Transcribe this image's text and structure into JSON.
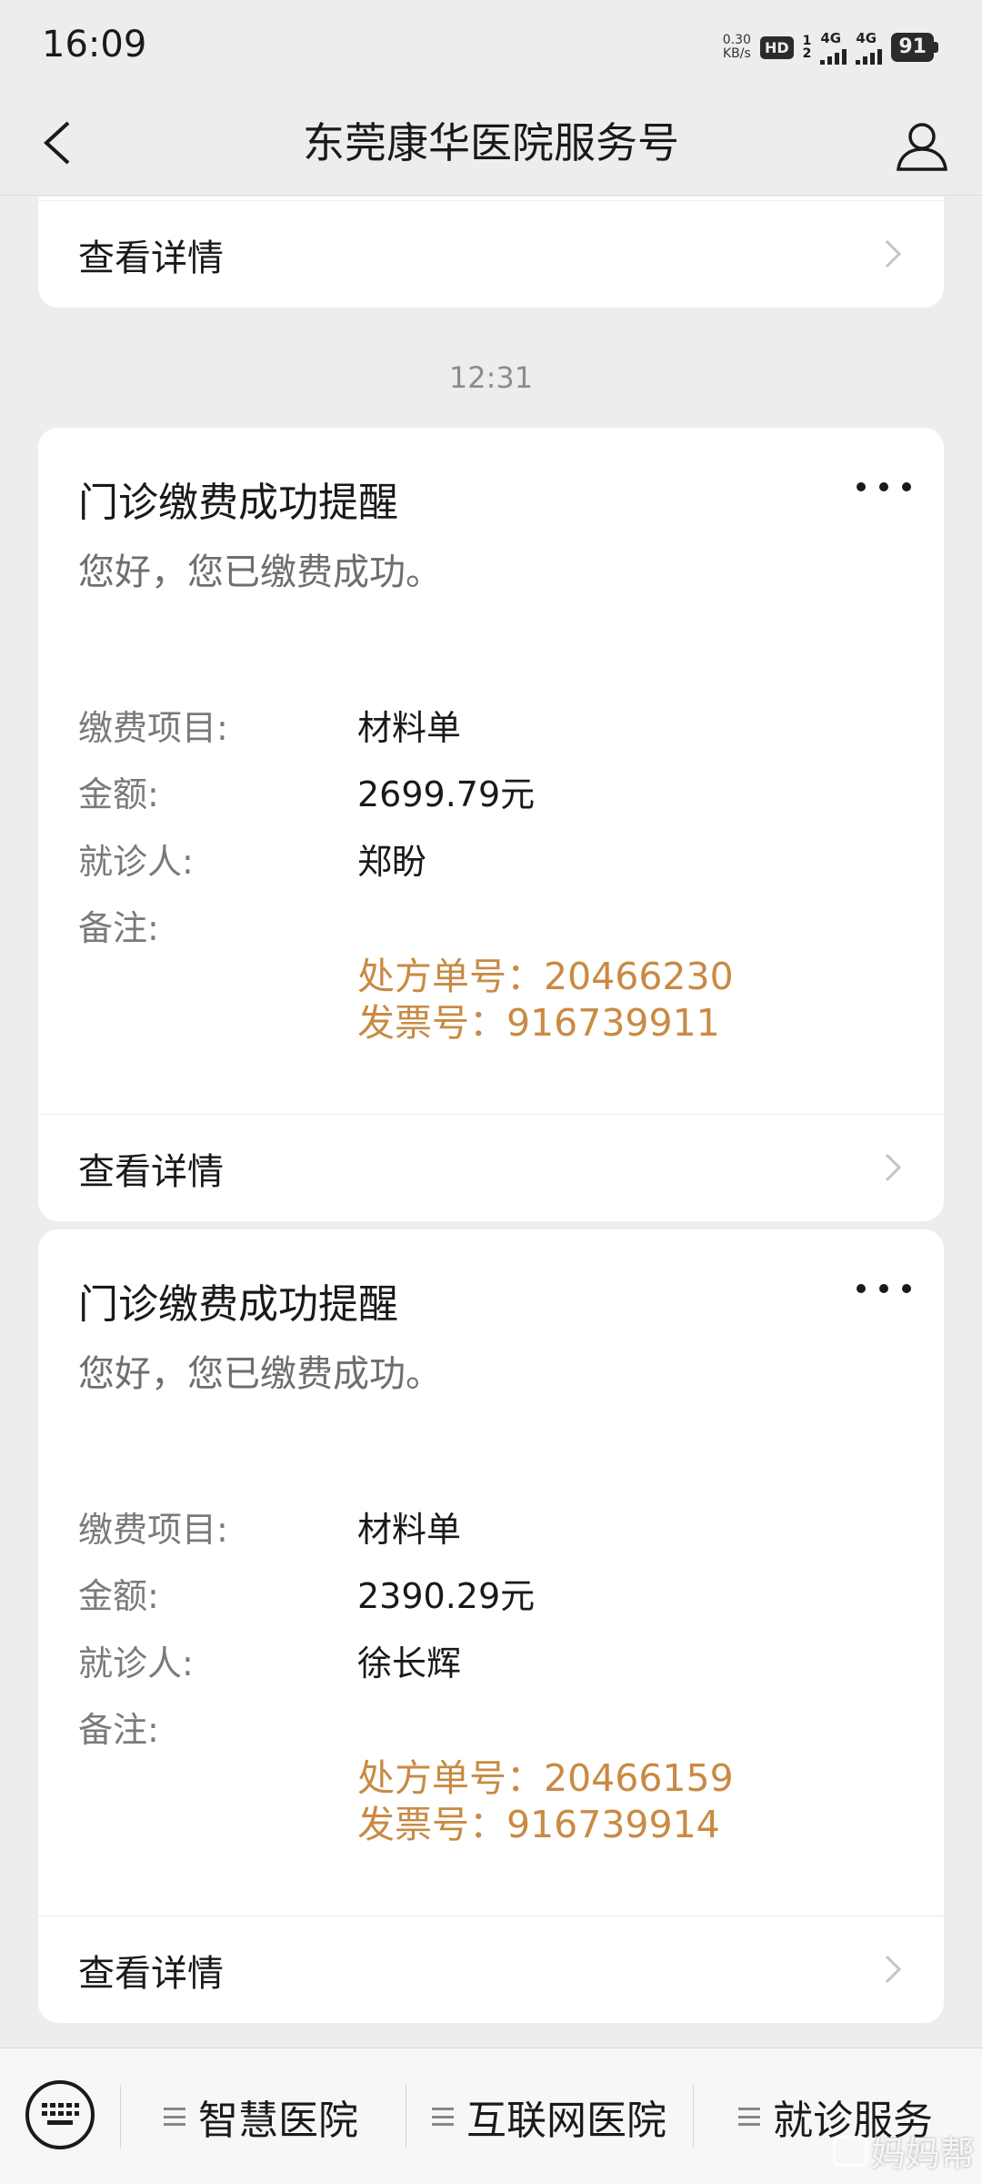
{
  "status_bar": {
    "time": "16:09",
    "net_speed_value": "0.30",
    "net_speed_unit": "KB/s",
    "hd_label": "HD",
    "sim_top": "1",
    "sim_bottom": "2",
    "net_type_1": "4G",
    "net_type_2": "4G",
    "battery": "91"
  },
  "nav": {
    "title": "东莞康华医院服务号"
  },
  "chat": {
    "top_card": {
      "details_label": "查看详情"
    },
    "timestamp": "12:31",
    "messages": [
      {
        "title": "门诊缴费成功提醒",
        "greeting": "您好，您已缴费成功。",
        "fields": [
          {
            "label": "缴费项目:",
            "value": "材料单"
          },
          {
            "label": "金额:",
            "value": "2699.79元"
          },
          {
            "label": "就诊人:",
            "value": "郑盼"
          },
          {
            "label": "备注:",
            "value": ""
          }
        ],
        "remark_lines": [
          "处方单号：20466230",
          "发票号：916739911"
        ],
        "details_label": "查看详情"
      },
      {
        "title": "门诊缴费成功提醒",
        "greeting": "您好，您已缴费成功。",
        "fields": [
          {
            "label": "缴费项目:",
            "value": "材料单"
          },
          {
            "label": "金额:",
            "value": "2390.29元"
          },
          {
            "label": "就诊人:",
            "value": "徐长辉"
          },
          {
            "label": "备注:",
            "value": ""
          }
        ],
        "remark_lines": [
          "处方单号：20466159",
          "发票号：916739914"
        ],
        "details_label": "查看详情"
      }
    ]
  },
  "bottom_menu": {
    "items": [
      {
        "label": "智慧医院"
      },
      {
        "label": "互联网医院"
      },
      {
        "label": "就诊服务"
      }
    ],
    "watermark": "妈妈帮"
  },
  "colors": {
    "background": "#ededed",
    "card": "#ffffff",
    "remark_accent": "#c98a43",
    "label_gray": "#7a7a7a"
  },
  "icons": [
    "back-arrow-icon",
    "profile-icon",
    "chevron-right-icon",
    "more-dots-icon",
    "keyboard-icon",
    "menu-list-icon"
  ]
}
